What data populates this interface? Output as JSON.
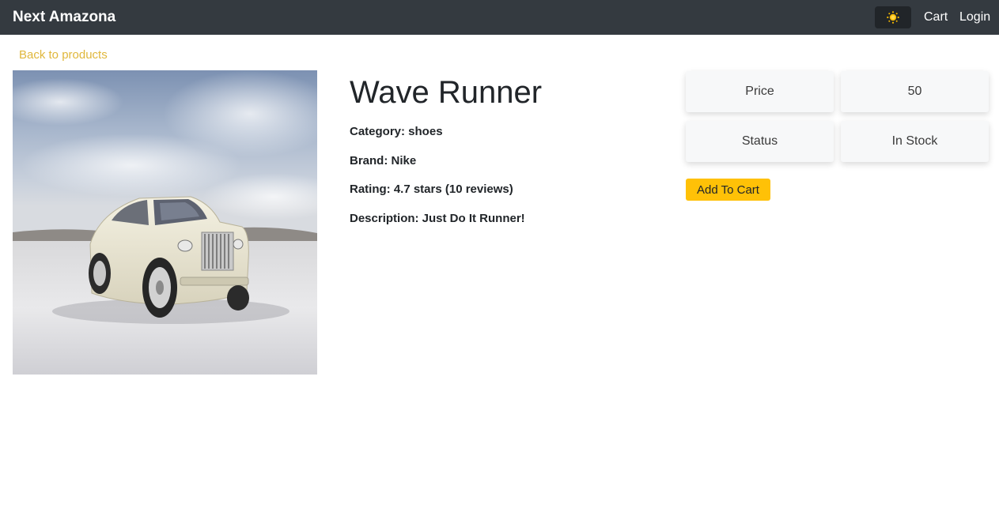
{
  "navbar": {
    "brand": "Next Amazona",
    "theme_icon": "sun-icon",
    "links": {
      "cart": "Cart",
      "login": "Login"
    }
  },
  "back_link": "Back to products",
  "product": {
    "image_alt": "Wave Runner",
    "name": "Wave Runner",
    "category": "Category: shoes",
    "brand": "Brand: Nike",
    "rating": "Rating: 4.7 stars (10 reviews)",
    "description": "Description: Just Do It Runner!"
  },
  "purchase_card": {
    "price_label": "Price",
    "price_value": "50",
    "status_label": "Status",
    "status_value": "In Stock",
    "add_to_cart_label": "Add To Cart"
  },
  "colors": {
    "navbar_bg": "#343a40",
    "accent_link": "#e0b73b",
    "button_bg": "#ffc107"
  }
}
